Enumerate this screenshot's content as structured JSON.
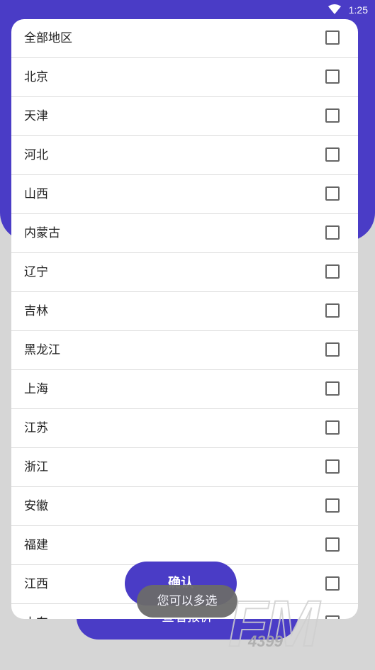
{
  "status_bar": {
    "time": "1:25"
  },
  "background": {
    "button_label": "查看报价"
  },
  "region_list": {
    "items": [
      {
        "label": "全部地区"
      },
      {
        "label": "北京"
      },
      {
        "label": "天津"
      },
      {
        "label": "河北"
      },
      {
        "label": "山西"
      },
      {
        "label": "内蒙古"
      },
      {
        "label": "辽宁"
      },
      {
        "label": "吉林"
      },
      {
        "label": "黑龙江"
      },
      {
        "label": "上海"
      },
      {
        "label": "江苏"
      },
      {
        "label": "浙江"
      },
      {
        "label": "安徽"
      },
      {
        "label": "福建"
      },
      {
        "label": "江西"
      },
      {
        "label": "山东"
      }
    ]
  },
  "confirm_button": {
    "label": "确认"
  },
  "toast": {
    "text": "您可以多选"
  },
  "watermark": {
    "brand": "FM",
    "number": "4399"
  },
  "colors": {
    "accent": "#4a3cc6",
    "toast": "#6b6b6b"
  }
}
